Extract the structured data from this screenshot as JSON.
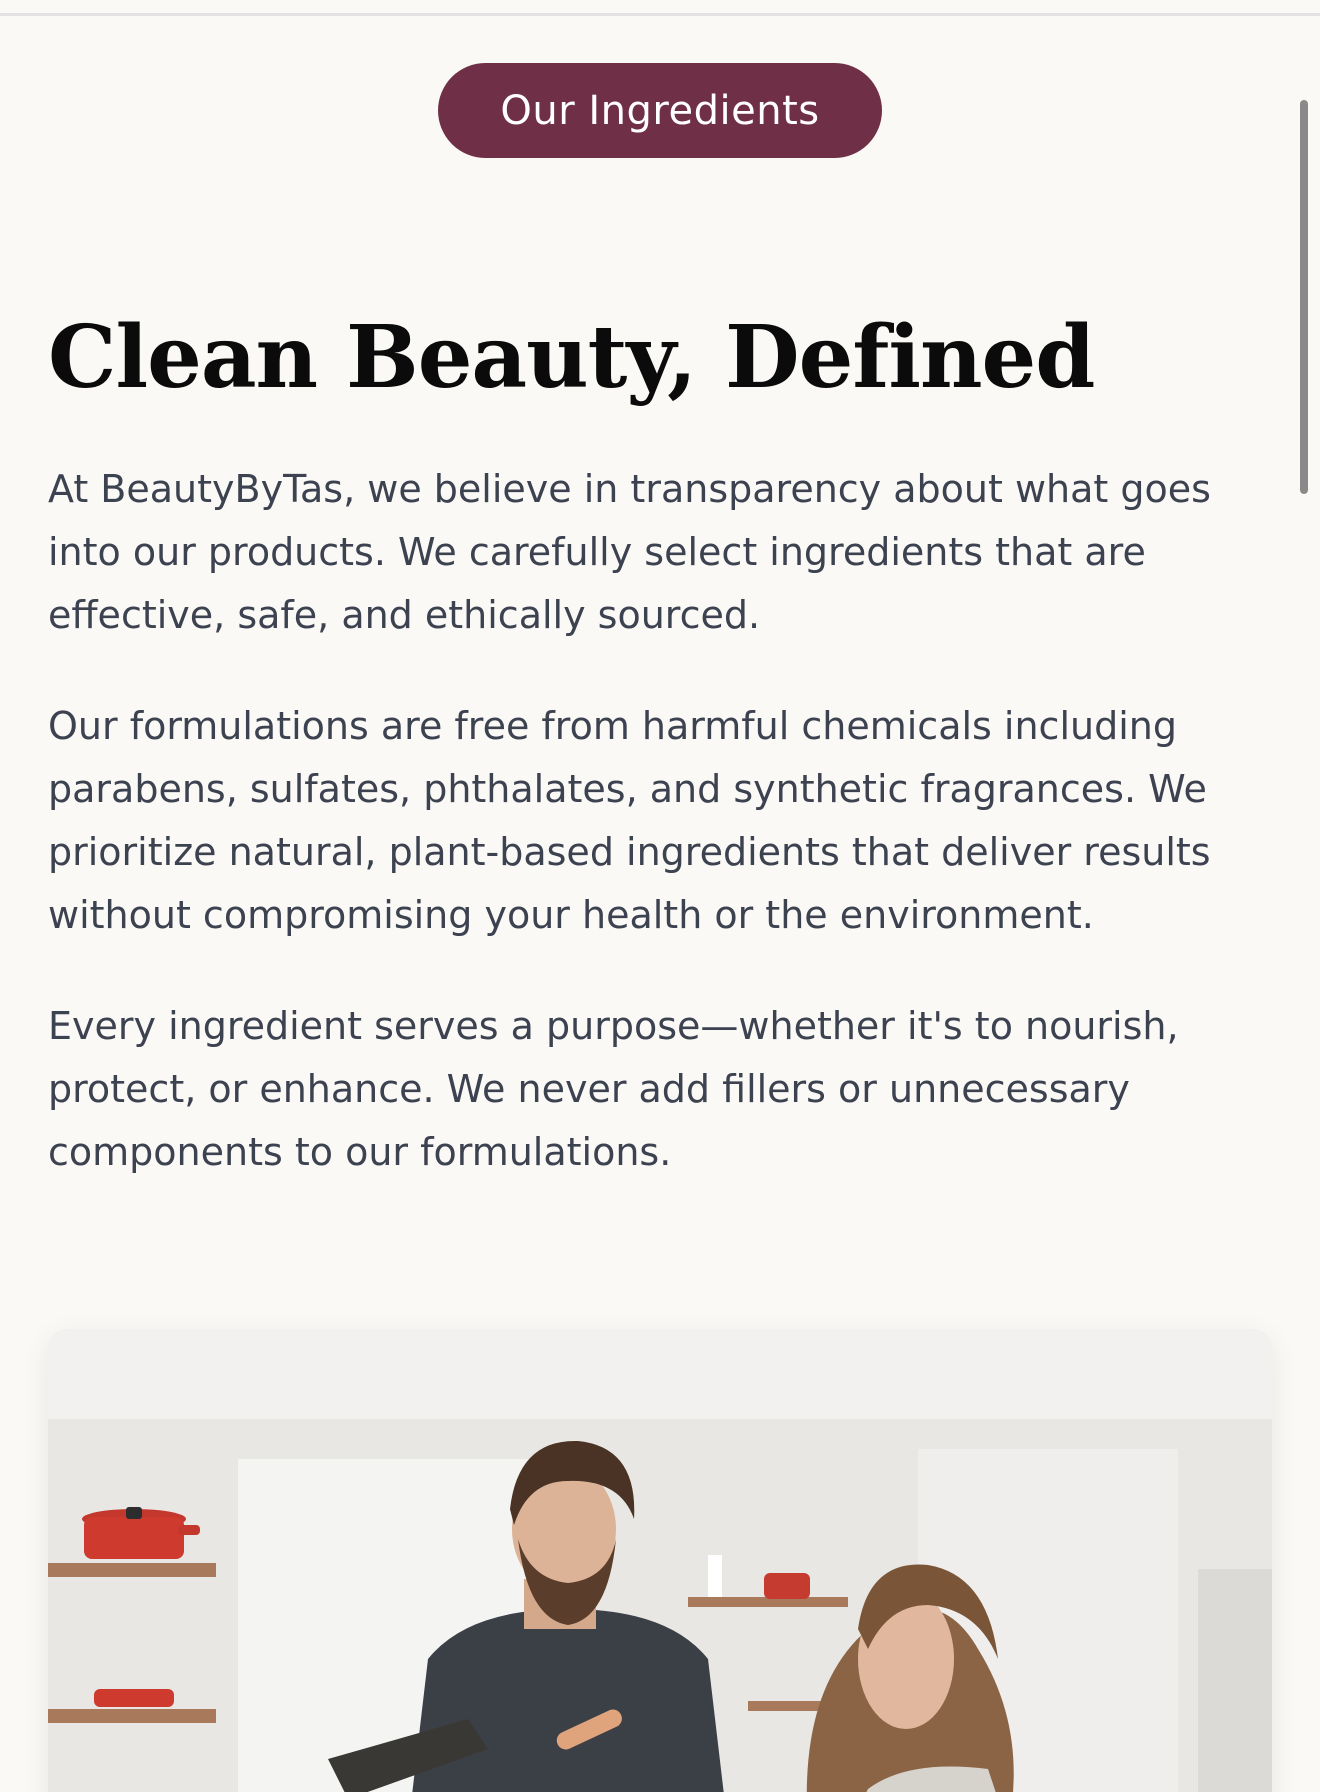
{
  "section_badge": "Our Ingredients",
  "heading": "Clean Beauty, Defined",
  "paragraphs": [
    "At BeautyByTas, we believe in transparency about what goes into our products. We carefully select ingredients that are effective, safe, and ethically sourced.",
    "Our formulations are free from harmful chemicals including parabens, sulfates, phthalates, and synthetic fragrances. We prioritize natural, plant-based ingredients that deliver results without compromising your health or the environment.",
    "Every ingredient serves a purpose—whether it's to nourish, protect, or enhance. We never add fillers or unnecessary components to our formulations."
  ],
  "colors": {
    "accent": "#6e2f47",
    "background": "#faf9f6",
    "heading": "#0b0b0b",
    "body_text": "#3d4250"
  },
  "image": {
    "icon": "kitchen-photo",
    "depicts": "two people in a bright kitchen"
  }
}
